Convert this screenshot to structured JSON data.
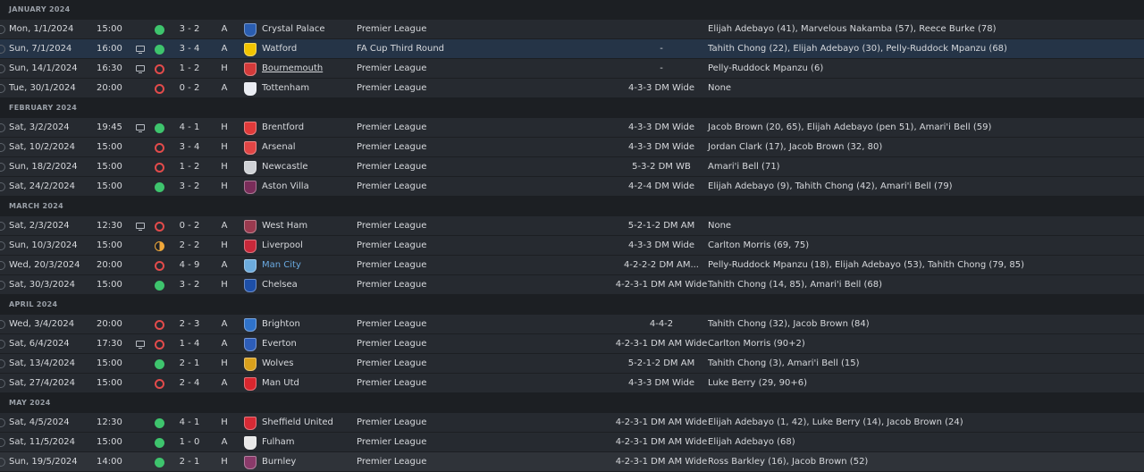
{
  "months": [
    {
      "label": "JANUARY 2024",
      "matches": [
        {
          "date": "Mon, 1/1/2024",
          "time": "15:00",
          "tv": false,
          "result": "win",
          "score": "3 - 2",
          "venue": "A",
          "opponent": "Crystal Palace",
          "crest_color": "#2a5db0",
          "competition": "Premier League",
          "formation": "",
          "scorers": "Elijah Adebayo (41), Marvelous Nakamba (57), Reece Burke (78)"
        },
        {
          "date": "Sun, 7/1/2024",
          "time": "16:00",
          "tv": true,
          "result": "win",
          "score": "3 - 4",
          "venue": "A",
          "opponent": "Watford",
          "crest_color": "#f2c400",
          "competition": "FA Cup Third Round",
          "formation": "-",
          "scorers": "Tahith Chong (22), Elijah Adebayo (30), Pelly-Ruddock Mpanzu (68)",
          "highlight": true
        },
        {
          "date": "Sun, 14/1/2024",
          "time": "16:30",
          "tv": true,
          "result": "loss",
          "score": "1 - 2",
          "venue": "H",
          "opponent": "Bournemouth",
          "crest_color": "#d33a3a",
          "competition": "Premier League",
          "formation": "-",
          "scorers": "Pelly-Ruddock Mpanzu (6)",
          "underline": true
        },
        {
          "date": "Tue, 30/1/2024",
          "time": "20:00",
          "tv": false,
          "result": "loss",
          "score": "0 - 2",
          "venue": "A",
          "opponent": "Tottenham",
          "crest_color": "#e9ecf2",
          "competition": "Premier League",
          "formation": "4-3-3 DM Wide",
          "scorers": "None"
        }
      ]
    },
    {
      "label": "FEBRUARY 2024",
      "matches": [
        {
          "date": "Sat, 3/2/2024",
          "time": "19:45",
          "tv": true,
          "result": "win",
          "score": "4 - 1",
          "venue": "H",
          "opponent": "Brentford",
          "crest_color": "#e03a3a",
          "competition": "Premier League",
          "formation": "4-3-3 DM Wide",
          "scorers": "Jacob Brown (20, 65), Elijah Adebayo (pen 51), Amari'i Bell (59)"
        },
        {
          "date": "Sat, 10/2/2024",
          "time": "15:00",
          "tv": false,
          "result": "loss",
          "score": "3 - 4",
          "venue": "H",
          "opponent": "Arsenal",
          "crest_color": "#e04545",
          "competition": "Premier League",
          "formation": "4-3-3 DM Wide",
          "scorers": "Jordan Clark (17), Jacob Brown (32, 80)"
        },
        {
          "date": "Sun, 18/2/2024",
          "time": "15:00",
          "tv": false,
          "result": "loss",
          "score": "1 - 2",
          "venue": "H",
          "opponent": "Newcastle",
          "crest_color": "#cfd2d6",
          "competition": "Premier League",
          "formation": "5-3-2 DM WB",
          "scorers": "Amari'i Bell (71)"
        },
        {
          "date": "Sat, 24/2/2024",
          "time": "15:00",
          "tv": false,
          "result": "win",
          "score": "3 - 2",
          "venue": "H",
          "opponent": "Aston Villa",
          "crest_color": "#7a2d5a",
          "competition": "Premier League",
          "formation": "4-2-4 DM Wide",
          "scorers": "Elijah Adebayo (9), Tahith Chong (42), Amari'i Bell (79)"
        }
      ]
    },
    {
      "label": "MARCH 2024",
      "matches": [
        {
          "date": "Sat, 2/3/2024",
          "time": "12:30",
          "tv": true,
          "result": "loss",
          "score": "0 - 2",
          "venue": "A",
          "opponent": "West Ham",
          "crest_color": "#9a3a4f",
          "competition": "Premier League",
          "formation": "5-2-1-2 DM AM",
          "scorers": "None"
        },
        {
          "date": "Sun, 10/3/2024",
          "time": "15:00",
          "tv": false,
          "result": "draw",
          "score": "2 - 2",
          "venue": "H",
          "opponent": "Liverpool",
          "crest_color": "#c8283a",
          "competition": "Premier League",
          "formation": "4-3-3 DM Wide",
          "scorers": "Carlton Morris (69, 75)"
        },
        {
          "date": "Wed, 20/3/2024",
          "time": "20:00",
          "tv": false,
          "result": "loss",
          "score": "4 - 9",
          "venue": "A",
          "opponent": "Man City",
          "crest_color": "#6cabdd",
          "competition": "Premier League",
          "formation": "4-2-2-2 DM AM...",
          "scorers": "Pelly-Ruddock Mpanzu (18), Elijah Adebayo (53), Tahith Chong (79, 85)",
          "link": true
        },
        {
          "date": "Sat, 30/3/2024",
          "time": "15:00",
          "tv": false,
          "result": "win",
          "score": "3 - 2",
          "venue": "H",
          "opponent": "Chelsea",
          "crest_color": "#1d4fa8",
          "competition": "Premier League",
          "formation": "4-2-3-1 DM AM Wide",
          "scorers": "Tahith Chong (14, 85), Amari'i Bell (68)"
        }
      ]
    },
    {
      "label": "APRIL 2024",
      "matches": [
        {
          "date": "Wed, 3/4/2024",
          "time": "20:00",
          "tv": false,
          "result": "loss",
          "score": "2 - 3",
          "venue": "A",
          "opponent": "Brighton",
          "crest_color": "#2f72c9",
          "competition": "Premier League",
          "formation": "4-4-2",
          "scorers": "Tahith Chong (32), Jacob Brown (84)"
        },
        {
          "date": "Sat, 6/4/2024",
          "time": "17:30",
          "tv": true,
          "result": "loss",
          "score": "1 - 4",
          "venue": "A",
          "opponent": "Everton",
          "crest_color": "#2d5db8",
          "competition": "Premier League",
          "formation": "4-2-3-1 DM AM Wide",
          "scorers": "Carlton Morris (90+2)"
        },
        {
          "date": "Sat, 13/4/2024",
          "time": "15:00",
          "tv": false,
          "result": "win",
          "score": "2 - 1",
          "venue": "H",
          "opponent": "Wolves",
          "crest_color": "#d9a01c",
          "competition": "Premier League",
          "formation": "5-2-1-2 DM AM",
          "scorers": "Tahith Chong (3), Amari'i Bell (15)"
        },
        {
          "date": "Sat, 27/4/2024",
          "time": "15:00",
          "tv": false,
          "result": "loss",
          "score": "2 - 4",
          "venue": "A",
          "opponent": "Man Utd",
          "crest_color": "#d8262e",
          "competition": "Premier League",
          "formation": "4-3-3 DM Wide",
          "scorers": "Luke Berry (29, 90+6)"
        }
      ]
    },
    {
      "label": "MAY 2024",
      "matches": [
        {
          "date": "Sat, 4/5/2024",
          "time": "12:30",
          "tv": false,
          "result": "win",
          "score": "4 - 1",
          "venue": "H",
          "opponent": "Sheffield United",
          "crest_color": "#d62a35",
          "competition": "Premier League",
          "formation": "4-2-3-1 DM AM Wide",
          "scorers": "Elijah Adebayo (1, 42), Luke Berry (14), Jacob Brown (24)"
        },
        {
          "date": "Sat, 11/5/2024",
          "time": "15:00",
          "tv": false,
          "result": "win",
          "score": "1 - 0",
          "venue": "A",
          "opponent": "Fulham",
          "crest_color": "#e8e8e8",
          "competition": "Premier League",
          "formation": "4-2-3-1 DM AM Wide",
          "scorers": "Elijah Adebayo (68)"
        },
        {
          "date": "Sun, 19/5/2024",
          "time": "14:00",
          "tv": false,
          "result": "win",
          "score": "2 - 1",
          "venue": "H",
          "opponent": "Burnley",
          "crest_color": "#8a3a6a",
          "competition": "Premier League",
          "formation": "4-2-3-1 DM AM Wide",
          "scorers": "Ross Barkley (16), Jacob Brown (52)",
          "last": true
        }
      ]
    }
  ]
}
